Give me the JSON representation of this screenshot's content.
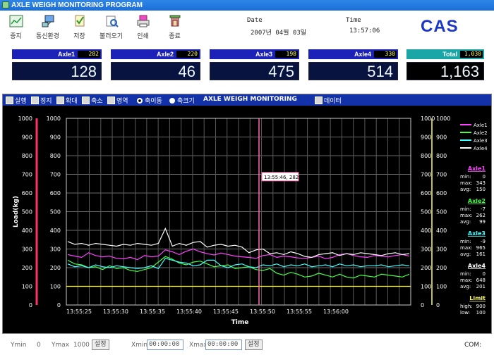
{
  "window": {
    "title": "AXLE WEIGH MONITORING PROGRAM"
  },
  "toolbar": [
    {
      "label": "중지",
      "icon": "chart-stop-icon"
    },
    {
      "label": "통신환경",
      "icon": "computer-network-icon"
    },
    {
      "label": "저장",
      "icon": "save-icon"
    },
    {
      "label": "불러오기",
      "icon": "open-icon"
    },
    {
      "label": "인쇄",
      "icon": "print-icon"
    },
    {
      "label": "종료",
      "icon": "exit-icon"
    }
  ],
  "datetime": {
    "date_label": "Date",
    "time_label": "Time",
    "date": "2007년 04월 03일",
    "time": "13:57:06"
  },
  "brand": "CAS",
  "axles": [
    {
      "name": "Axle1",
      "peak": "282",
      "value": "128"
    },
    {
      "name": "Axle2",
      "peak": "220",
      "value": "46"
    },
    {
      "name": "Axle3",
      "peak": "198",
      "value": "475"
    },
    {
      "name": "Axle4",
      "peak": "330",
      "value": "514"
    },
    {
      "name": "Total",
      "peak": "1,030",
      "value": "1,163"
    }
  ],
  "graph_controls": {
    "run": "실행",
    "stop": "정지",
    "zoom_in": "확대",
    "zoom_out": "축소",
    "area": "영역",
    "axis_move": "축이동",
    "axis_size": "축크기",
    "title": "AXLE WEIGH MONITORING",
    "data": "데이터"
  },
  "chart_data": {
    "type": "line",
    "title": "",
    "xlabel": "Time",
    "ylabel": "Load(kg)",
    "ylim": [
      0,
      1000
    ],
    "yticks": [
      0,
      100,
      200,
      300,
      400,
      500,
      600,
      700,
      800,
      900,
      1000
    ],
    "xticks": [
      "13:55:25",
      "13:55:30",
      "13:55:35",
      "13:55:40",
      "13:55:45",
      "13:55:50",
      "13:55:55",
      "13:56:00"
    ],
    "grid": true,
    "cursor": {
      "time": "13:55:46",
      "label": "13:55:46, 282"
    },
    "limit_line": 100,
    "series": [
      {
        "name": "Axle1",
        "color": "#ff44ff",
        "values": [
          270,
          262,
          255,
          280,
          265,
          258,
          262,
          250,
          247,
          255,
          243,
          265,
          258,
          262,
          295,
          285,
          270,
          288,
          300,
          285,
          275,
          268,
          278,
          270,
          262,
          258,
          255,
          250,
          265,
          270,
          255,
          262,
          258,
          252,
          250,
          255,
          262,
          248,
          255,
          270,
          275,
          265,
          258,
          255,
          265,
          262,
          258,
          265,
          270,
          262
        ]
      },
      {
        "name": "Axle2",
        "color": "#44ff44",
        "values": [
          240,
          220,
          215,
          200,
          205,
          190,
          210,
          195,
          200,
          185,
          180,
          190,
          200,
          230,
          260,
          245,
          225,
          215,
          230,
          235,
          220,
          205,
          210,
          215,
          195,
          200,
          205,
          190,
          185,
          195,
          170,
          160,
          175,
          165,
          150,
          155,
          170,
          160,
          150,
          165,
          150,
          145,
          160,
          155,
          150,
          165,
          160,
          155,
          150,
          165
        ]
      },
      {
        "name": "Axle3",
        "color": "#44ffff",
        "values": [
          220,
          205,
          210,
          200,
          215,
          205,
          200,
          210,
          205,
          200,
          195,
          200,
          210,
          195,
          250,
          240,
          230,
          225,
          210,
          215,
          240,
          240,
          210,
          200,
          215,
          220,
          205,
          200,
          215,
          210,
          220,
          205,
          215,
          210,
          220,
          205,
          210,
          215,
          205,
          220,
          210,
          215,
          205,
          210,
          210,
          215,
          205,
          210,
          215,
          210
        ]
      },
      {
        "name": "Axle4",
        "color": "#ffffff",
        "values": [
          340,
          325,
          330,
          320,
          330,
          325,
          320,
          315,
          325,
          320,
          330,
          325,
          320,
          330,
          410,
          315,
          330,
          320,
          335,
          340,
          310,
          320,
          325,
          315,
          320,
          310,
          280,
          295,
          300,
          275,
          280,
          270,
          285,
          275,
          260,
          255,
          270,
          275,
          280,
          265,
          275,
          270,
          280,
          275,
          270,
          265,
          275,
          280,
          270,
          275
        ]
      }
    ],
    "stats": [
      {
        "name": "Axle1",
        "min": "0",
        "max": "343",
        "avg": "150"
      },
      {
        "name": "Axle2",
        "min": "-7",
        "max": "262",
        "avg": "99"
      },
      {
        "name": "Axle3",
        "min": "-9",
        "max": "965",
        "avg": "161"
      },
      {
        "name": "Axle4",
        "min": "0",
        "max": "648",
        "avg": "201"
      }
    ],
    "limit": {
      "name": "Limit",
      "high": "900",
      "low": "100"
    },
    "stat_labels": {
      "min": "min:",
      "max": "max:",
      "avg": "avg:",
      "high": "high:",
      "low": "low:"
    }
  },
  "bottom": {
    "ymin_label": "Ymin",
    "ymin": "0",
    "ymax_label": "Ymax",
    "ymax": "1000",
    "apply": "설정",
    "xmin_label": "Xmin",
    "xmin": "00:00:00",
    "xmax_label": "Xmax",
    "xmax": "00:00:00",
    "apply2": "설정",
    "com": "COM:"
  }
}
